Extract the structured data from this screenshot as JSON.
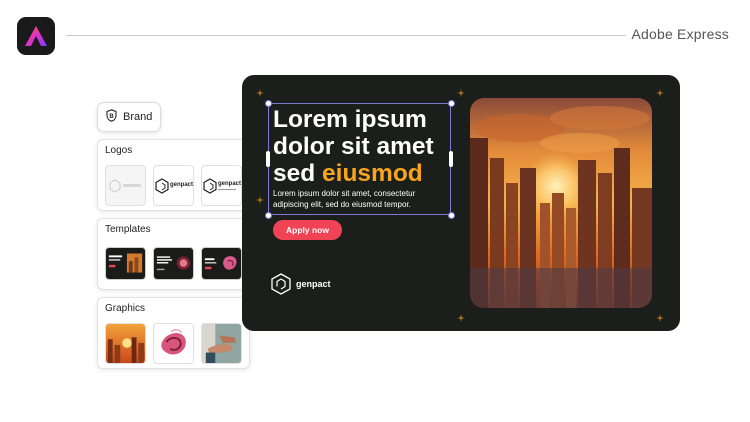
{
  "header": {
    "app_title": "Adobe Express"
  },
  "brand": {
    "label": "Brand"
  },
  "panels": {
    "logos": {
      "title": "Logos",
      "logo_text": "genpact"
    },
    "templates": {
      "title": "Templates"
    },
    "graphics": {
      "title": "Graphics"
    }
  },
  "canvas": {
    "headline_line1": "Lorem ipsum",
    "headline_line2": "dolor sit amet",
    "headline_line3_white": "sed ",
    "headline_line3_accent": "eiusmod",
    "body": "Lorem ipsum dolor sit amet, consectetur adipiscing elit, sed do eiusmod tempor.",
    "cta": "Apply now",
    "logo_text": "genpact"
  },
  "colors": {
    "accent": "#f7a51d",
    "cta": "#f04355",
    "canvas_bg": "#1c1e1b",
    "selection": "#7b7bd8"
  },
  "icons": [
    "adobe-express-logo-icon",
    "brand-shield-icon",
    "genpact-logo-icon",
    "sparkle-icon"
  ]
}
